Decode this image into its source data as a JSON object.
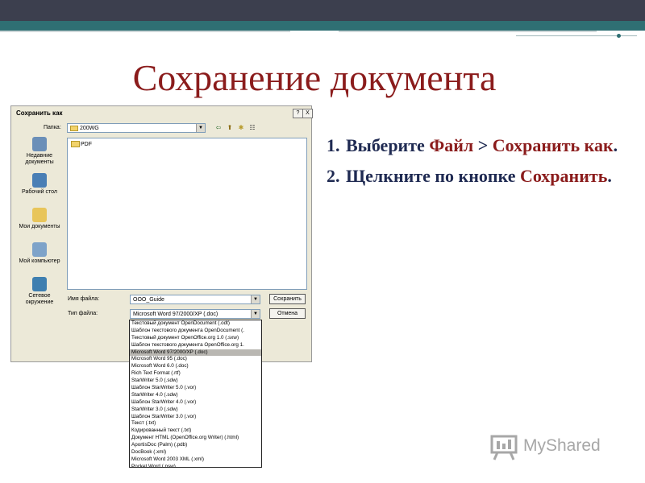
{
  "slide": {
    "title": "Сохранение документа",
    "steps": [
      {
        "num": "1.",
        "text_a": "Выберите ",
        "text_red": "Файл",
        "text_b": " > ",
        "text_red2": "Сохранить как",
        "text_end": "."
      },
      {
        "num": "2.",
        "text_a": "Щелкните по кнопке ",
        "text_red": "Сохранить",
        "text_end": "."
      }
    ]
  },
  "dialog": {
    "title": "Сохранить как",
    "help_label": "?",
    "close_label": "X",
    "folder_label": "Папка:",
    "folder_value": "200WG",
    "folder_item": "PDF",
    "places": [
      {
        "label": "Недавние документы",
        "icon": "recent-documents-icon"
      },
      {
        "label": "Рабочий стол",
        "icon": "desktop-icon"
      },
      {
        "label": "Мои документы",
        "icon": "my-documents-icon"
      },
      {
        "label": "Мой компьютер",
        "icon": "my-computer-icon"
      },
      {
        "label": "Сетевое окружение",
        "icon": "network-icon"
      }
    ],
    "filename_label": "Имя файла:",
    "filename_value": "OOO_Guide",
    "filetype_label": "Тип файла:",
    "filetype_value": "Microsoft Word 97/2000/XP (.doc)",
    "save_label": "Сохранить",
    "cancel_label": "Отмена",
    "filetype_options": [
      "Текстовый документ OpenDocument (.odt)",
      "Шаблон текстового документа OpenDocument (.",
      "Текстовый документ OpenOffice.org 1.0 (.sxw)",
      "Шаблон текстового документа OpenOffice.org 1.",
      "Microsoft Word 97/2000/XP (.doc)",
      "Microsoft Word 95 (.doc)",
      "Microsoft Word 6.0 (.doc)",
      "Rich Text Format (.rtf)",
      "StarWriter 5.0 (.sdw)",
      "Шаблон StarWriter 5.0 (.vor)",
      "StarWriter 4.0 (.sdw)",
      "Шаблон StarWriter 4.0 (.vor)",
      "StarWriter 3.0 (.sdw)",
      "Шаблон StarWriter 3.0 (.vor)",
      "Текст (.txt)",
      "Кодированный текст (.txt)",
      "Документ HTML (OpenOffice.org Writer) (.html)",
      "AportisDoc (Palm) (.pdb)",
      "DocBook (.xml)",
      "Microsoft Word 2003 XML (.xml)",
      "Pocket Word (.psw)"
    ],
    "selected_index": 4
  },
  "logo": {
    "text": "MyShared"
  },
  "colors": {
    "title": "#8b1c1c",
    "steps": "#1f2a52",
    "topbar": "#3c3f4e",
    "accent": "#2f6f73"
  }
}
